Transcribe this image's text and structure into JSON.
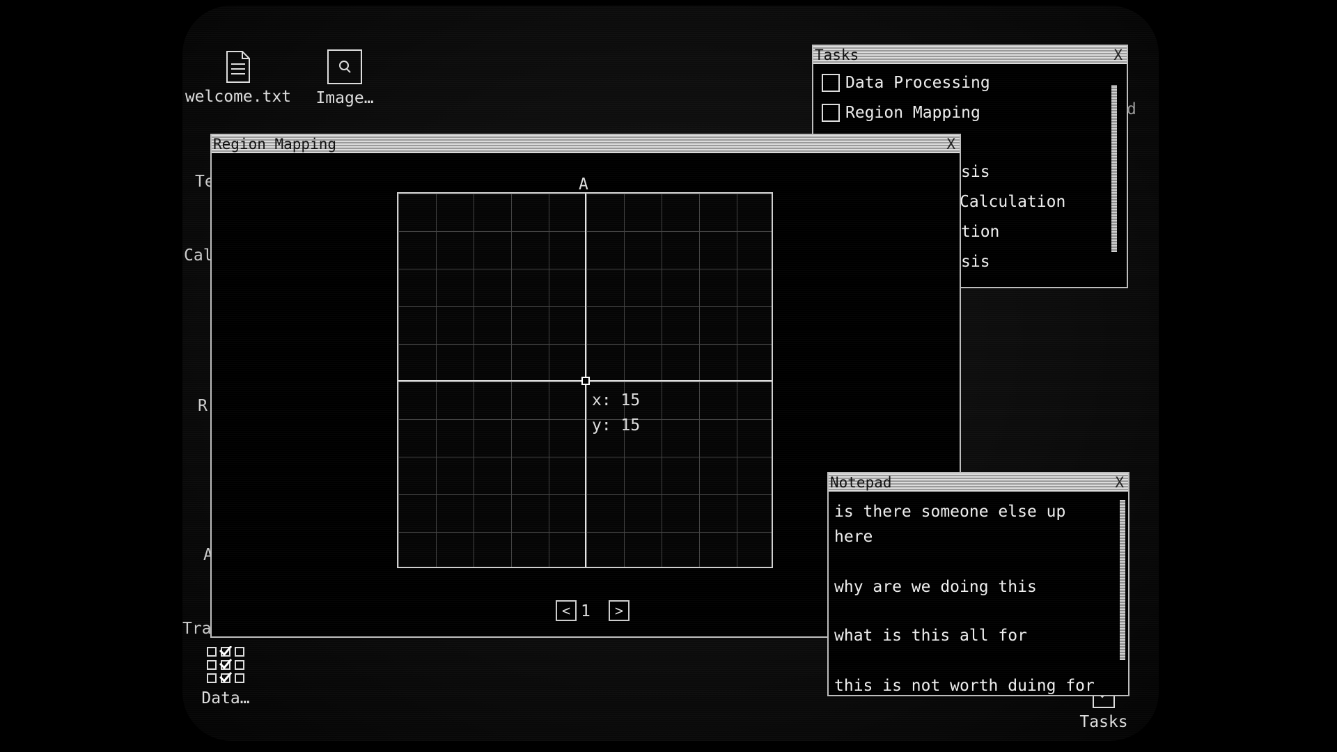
{
  "desktop": {
    "icons": [
      {
        "label": "welcome.txt",
        "icon": "document-icon"
      },
      {
        "label": "Image…",
        "icon": "image-viewer-icon"
      },
      {
        "label": "Data…",
        "icon": "checklist-grid-icon"
      },
      {
        "label": "Tasks",
        "icon": "tasks-icon"
      }
    ],
    "partial_labels": [
      "Te",
      "Cal",
      "R",
      "A",
      "Tra"
    ]
  },
  "tasks_window": {
    "title": "Tasks",
    "close_label": "X",
    "items": [
      {
        "label": "Data Processing",
        "checked": false
      },
      {
        "label": "Region Mapping",
        "checked": false
      },
      {
        "label": "sis"
      },
      {
        "label": "Calculation"
      },
      {
        "label": "tion"
      },
      {
        "label": "sis"
      }
    ],
    "edge_fragment": "d"
  },
  "region_window": {
    "title": "Region Mapping",
    "close_label": "X",
    "grid_title": "A",
    "coord_x": "x: 15",
    "coord_y": "y: 15",
    "page": "1",
    "prev_label": "<",
    "next_label": ">"
  },
  "notepad": {
    "title": "Notepad",
    "close_label": "X",
    "lines": [
      "is there someone else up",
      "here",
      "why are we doing this",
      "what is this all for",
      "this is not worth duing for"
    ]
  }
}
